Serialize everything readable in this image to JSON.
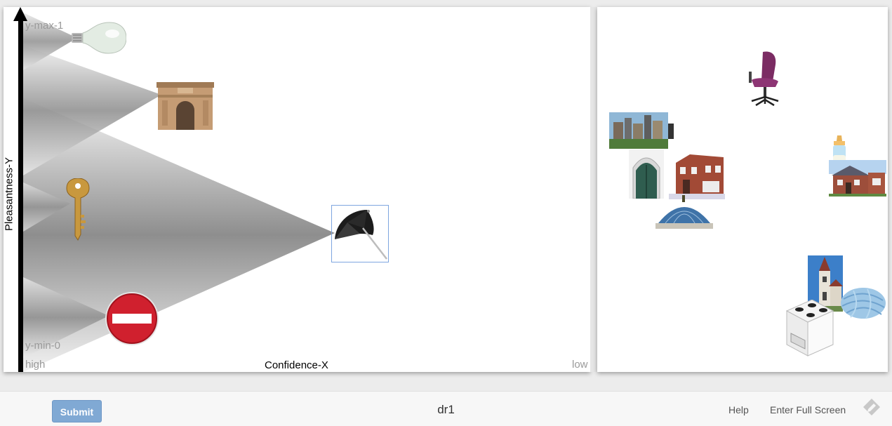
{
  "axes": {
    "y_title": "Pleasantness-Y",
    "x_title": "Confidence-X",
    "y_max_label": "y-max-1",
    "y_min_label": "y-min-0",
    "x_high_label": "high",
    "x_low_label": "low"
  },
  "stimuli_placed": [
    {
      "name": "light bulb",
      "icon": "light-bulb-icon"
    },
    {
      "name": "arch",
      "icon": "triumphal-arch-icon"
    },
    {
      "name": "key",
      "icon": "key-icon"
    },
    {
      "name": "umbrella",
      "icon": "umbrella-icon",
      "selected": true
    },
    {
      "name": "no entry sign",
      "icon": "no-entry-sign-icon"
    }
  ],
  "stimuli_unplaced": [
    {
      "name": "office chair",
      "icon": "office-chair-icon"
    },
    {
      "name": "city skyline",
      "icon": "city-skyline-icon"
    },
    {
      "name": "gothic door",
      "icon": "gothic-door-icon"
    },
    {
      "name": "brick townhouse",
      "icon": "brick-townhouse-icon"
    },
    {
      "name": "glass dome",
      "icon": "glass-dome-icon"
    },
    {
      "name": "baby bottle",
      "icon": "baby-bottle-icon"
    },
    {
      "name": "suburban house",
      "icon": "suburban-house-icon"
    },
    {
      "name": "church",
      "icon": "church-icon"
    },
    {
      "name": "yarn ball",
      "icon": "yarn-ball-icon"
    },
    {
      "name": "stove",
      "icon": "stove-icon"
    }
  ],
  "footer": {
    "submit_label": "Submit",
    "title": "dr1",
    "help_label": "Help",
    "fullscreen_label": "Enter Full Screen",
    "logo_icon": "pencil-logo-icon"
  },
  "colors": {
    "submit": "#80a9d4",
    "selection": "#7ea6e0"
  }
}
